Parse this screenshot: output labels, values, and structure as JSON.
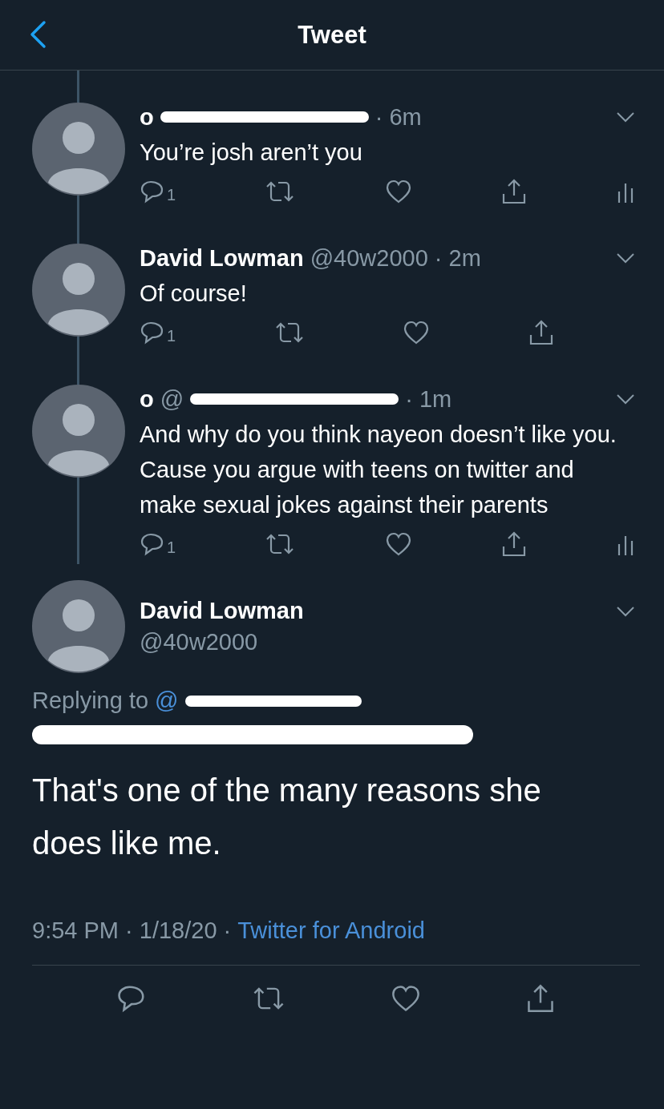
{
  "header": {
    "title": "Tweet"
  },
  "thread": [
    {
      "name": "o",
      "redacted": true,
      "time": "· 6m",
      "text": "You’re josh aren’t you",
      "replies": "1",
      "analytics": true
    },
    {
      "name": "David Lowman",
      "redacted": false,
      "handle": "@40w2000",
      "time": "· 2m",
      "text": "Of course!",
      "replies": "1",
      "analytics": false
    },
    {
      "name": "o",
      "redacted": true,
      "handle": "@",
      "time": "· 1m",
      "text": "And why do you think nayeon doesn’t like you. Cause you argue with teens on twitter and make sexual jokes against their parents",
      "replies": "1",
      "analytics": true
    }
  ],
  "main": {
    "name": "David Lowman",
    "handle": "@40w2000",
    "replying_label": "Replying to",
    "replying_handle": "@",
    "redacted": true,
    "text": "That's one of the many reasons she does like me.",
    "timestamp": "9:54 PM · 1/18/20 ·",
    "source": "Twitter for Android"
  }
}
